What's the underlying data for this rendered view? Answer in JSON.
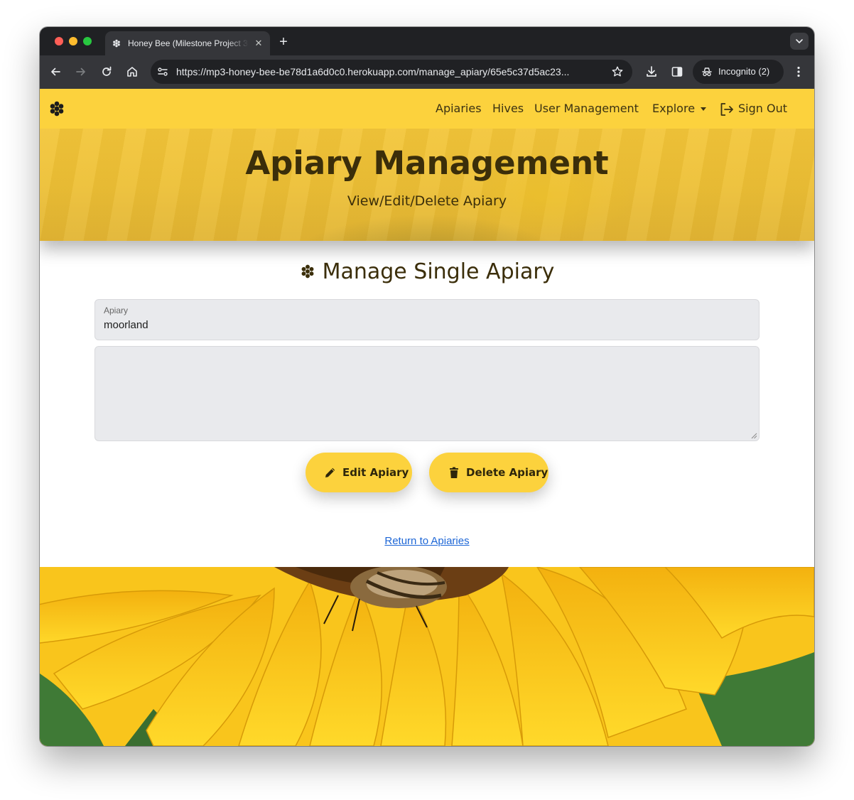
{
  "browser": {
    "tab_title": "Honey Bee (Milestone Project 3)",
    "url": "https://mp3-honey-bee-be78d1a6d0c0.herokuapp.com/manage_apiary/65e5c37d5ac23...",
    "incognito_label": "Incognito (2)"
  },
  "navbar": {
    "links": {
      "apiaries": "Apiaries",
      "hives": "Hives",
      "user_management": "User Management",
      "explore": "Explore",
      "sign_out": "Sign Out"
    }
  },
  "hero": {
    "title": "Apiary Management",
    "subtitle": "View/Edit/Delete Apiary"
  },
  "main": {
    "section_title": "Manage Single Apiary",
    "apiary_field": {
      "label": "Apiary",
      "value": "moorland"
    },
    "description_field": {
      "value": ""
    },
    "buttons": {
      "edit": "Edit Apiary",
      "delete": "Delete Apiary"
    },
    "return_link": "Return to Apiaries"
  },
  "theme": {
    "accent": "#fcd23d",
    "text_dark": "#3b2e0a",
    "link": "#1d66d6"
  }
}
